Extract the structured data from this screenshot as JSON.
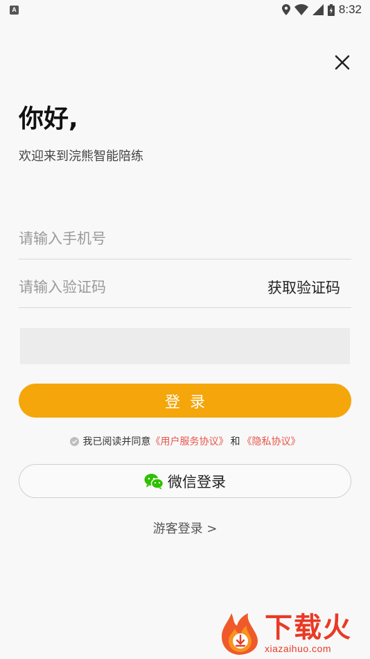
{
  "status_bar": {
    "notification_icon_letter": "A",
    "time": "8:32"
  },
  "login": {
    "greeting": "你好,",
    "welcome": "欢迎来到浣熊智能陪练",
    "phone_placeholder": "请输入手机号",
    "code_placeholder": "请输入验证码",
    "get_code_label": "获取验证码",
    "login_button_label": "登录",
    "agreement": {
      "prefix": "我已阅读并同意",
      "user_agreement": "《用户服务协议》",
      "and": "和",
      "privacy_policy": "《隐私协议》"
    },
    "wechat_login_label": "微信登录",
    "guest_login_label": "游客登录 >"
  },
  "watermark": {
    "title": "下载火",
    "url": "xiazaihuo.com"
  },
  "colors": {
    "accent": "#f5a60a",
    "link": "#e8554a",
    "wechat_green": "#2dc100",
    "background": "#f8f8f8"
  }
}
